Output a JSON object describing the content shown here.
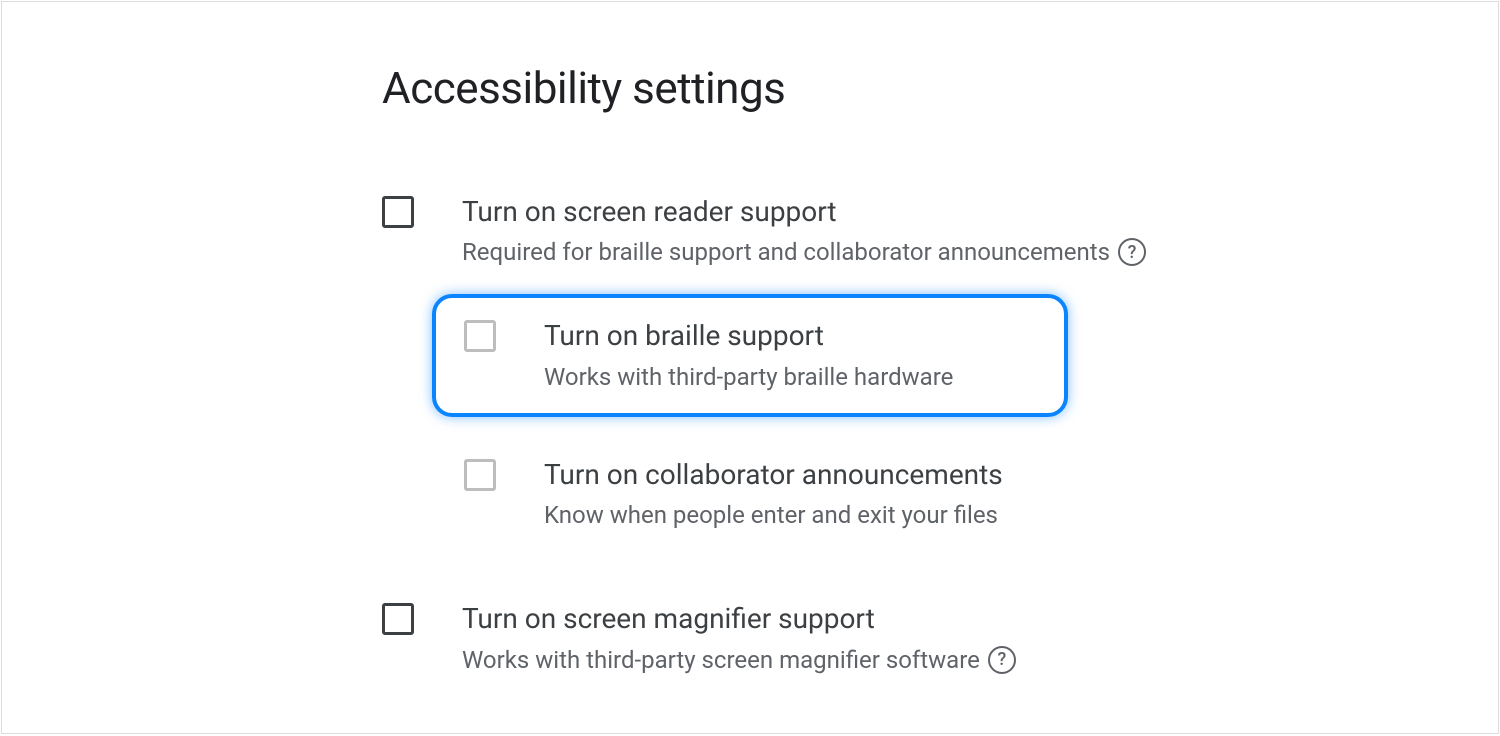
{
  "title": "Accessibility settings",
  "options": {
    "screen_reader": {
      "label": "Turn on screen reader support",
      "desc": "Required for braille support and collaborator announcements"
    },
    "braille": {
      "label": "Turn on braille support",
      "desc": "Works with third-party braille hardware"
    },
    "collaborator": {
      "label": "Turn on collaborator announcements",
      "desc": "Know when people enter and exit your files"
    },
    "magnifier": {
      "label": "Turn on screen magnifier support",
      "desc": "Works with third-party screen magnifier software"
    }
  }
}
